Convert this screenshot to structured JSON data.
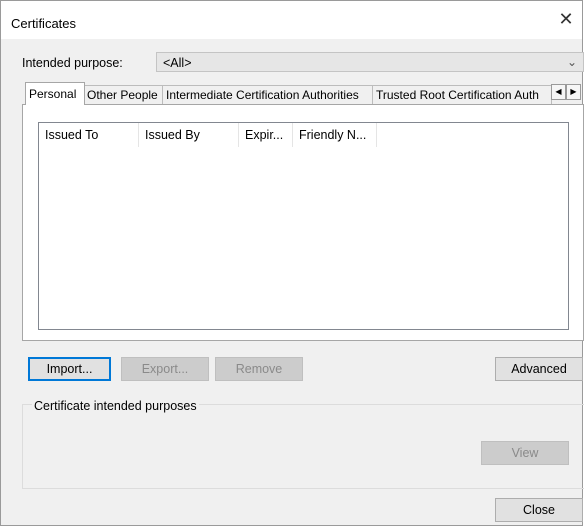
{
  "window": {
    "title": "Certificates"
  },
  "purpose": {
    "label": "Intended purpose:",
    "value": "<All>"
  },
  "tabs": [
    {
      "label": "Personal",
      "active": true
    },
    {
      "label": "Other People"
    },
    {
      "label": "Intermediate Certification Authorities"
    },
    {
      "label": "Trusted Root Certification Auth"
    }
  ],
  "list": {
    "columns": [
      "Issued To",
      "Issued By",
      "Expir...",
      "Friendly N..."
    ]
  },
  "buttons": {
    "import": "Import...",
    "export": "Export...",
    "remove": "Remove",
    "advanced": "Advanced",
    "view": "View",
    "close": "Close"
  },
  "group": {
    "label": "Certificate intended purposes"
  },
  "icons": {
    "close": "close-icon",
    "dropdown": "chevron-down-icon",
    "tab_left": "chevron-left-icon",
    "tab_right": "chevron-right-icon"
  }
}
